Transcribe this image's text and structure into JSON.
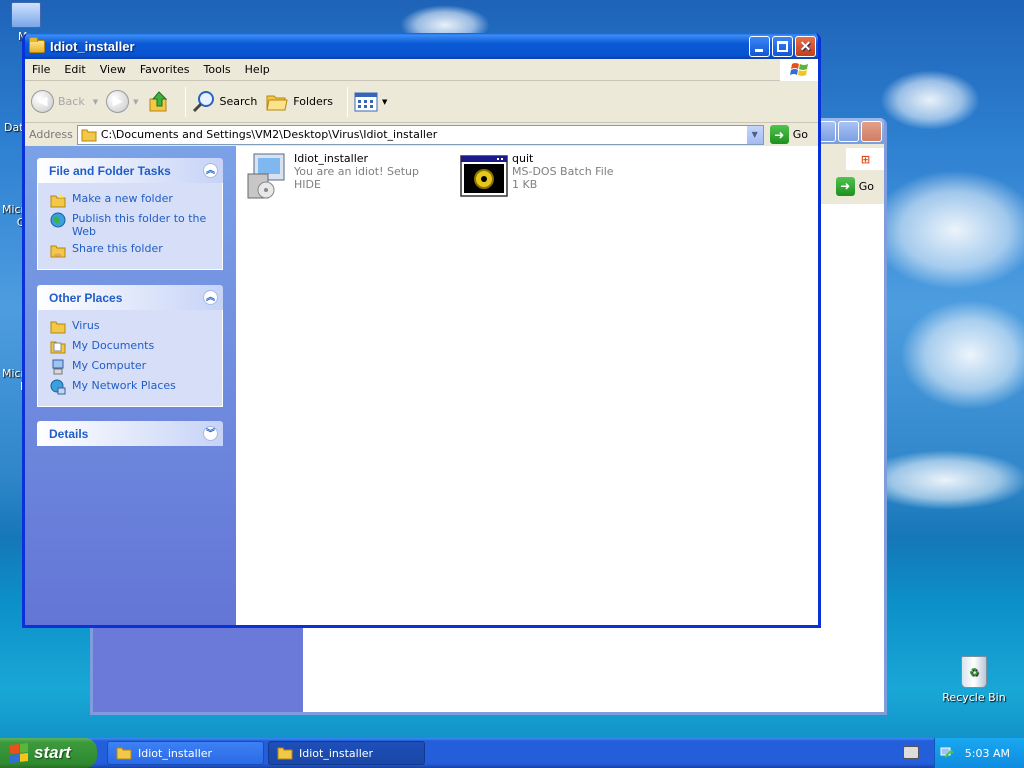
{
  "desktop": {
    "icons": [
      {
        "label": "My"
      },
      {
        "label": "Dat"
      },
      {
        "label": "Micr"
      },
      {
        "label": "C"
      },
      {
        "label": "Micro"
      },
      {
        "label": "B"
      },
      {
        "label": "Recycle Bin"
      }
    ]
  },
  "back_window": {
    "go_label": "Go"
  },
  "window": {
    "title": "Idiot_installer",
    "menu": [
      "File",
      "Edit",
      "View",
      "Favorites",
      "Tools",
      "Help"
    ],
    "toolbar": {
      "back": "Back",
      "search": "Search",
      "folders": "Folders"
    },
    "address": {
      "label": "Address",
      "value": "C:\\Documents and Settings\\VM2\\Desktop\\Virus\\Idiot_installer",
      "go": "Go"
    },
    "taskpane": {
      "file_tasks": {
        "title": "File and Folder Tasks",
        "links": [
          "Make a new folder",
          "Publish this folder to the Web",
          "Share this folder"
        ]
      },
      "other_places": {
        "title": "Other Places",
        "links": [
          "Virus",
          "My Documents",
          "My Computer",
          "My Network Places"
        ]
      },
      "details": {
        "title": "Details"
      }
    },
    "files": [
      {
        "name": "Idiot_installer",
        "line2": "You are an idiot! Setup",
        "line3": "HIDE"
      },
      {
        "name": "quit",
        "line2": "MS-DOS Batch File",
        "line3": "1 KB"
      }
    ]
  },
  "taskbar": {
    "start": "start",
    "apps": [
      "Idiot_installer",
      "Idiot_installer"
    ],
    "clock": "5:03 AM"
  },
  "colors": {
    "title_blue": "#0a5fe0",
    "task_link": "#215dc6",
    "start_green": "#3c9a3c"
  }
}
